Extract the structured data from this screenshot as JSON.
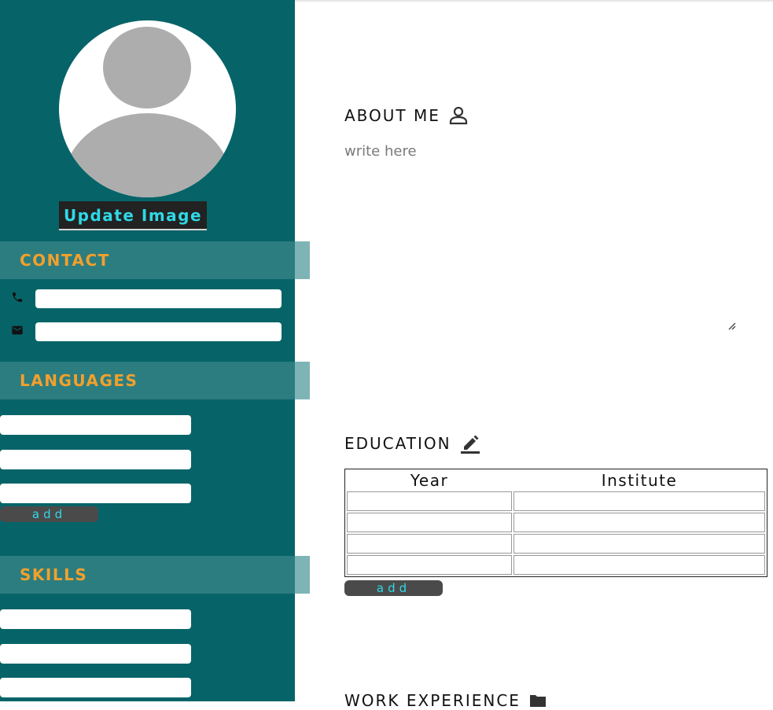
{
  "sidebar": {
    "update_image_label": "Update Image",
    "contact": {
      "title": "CONTACT",
      "phone_icon": "phone-icon",
      "email_icon": "mail-icon",
      "phone_value": "",
      "email_value": ""
    },
    "languages": {
      "title": "LANGUAGES",
      "items": [
        "",
        "",
        ""
      ],
      "add_label": "add"
    },
    "skills": {
      "title": "SKILLS",
      "items": [
        "",
        "",
        ""
      ]
    }
  },
  "main": {
    "about": {
      "title": "ABOUT ME",
      "icon": "person-icon",
      "placeholder": "write here"
    },
    "education": {
      "title": "EDUCATION",
      "icon": "pencil-icon",
      "columns": [
        "Year",
        "Institute"
      ],
      "rows": [
        [
          "",
          ""
        ],
        [
          "",
          ""
        ],
        [
          "",
          ""
        ],
        [
          "",
          ""
        ]
      ],
      "add_label": "add"
    },
    "work": {
      "title": "WORK EXPERIENCE",
      "icon": "folder-icon"
    }
  },
  "colors": {
    "sidebar": "#066468",
    "band": "#2c7d80",
    "heading_accent": "#f2a02c",
    "button_text": "#2fd8e6"
  }
}
